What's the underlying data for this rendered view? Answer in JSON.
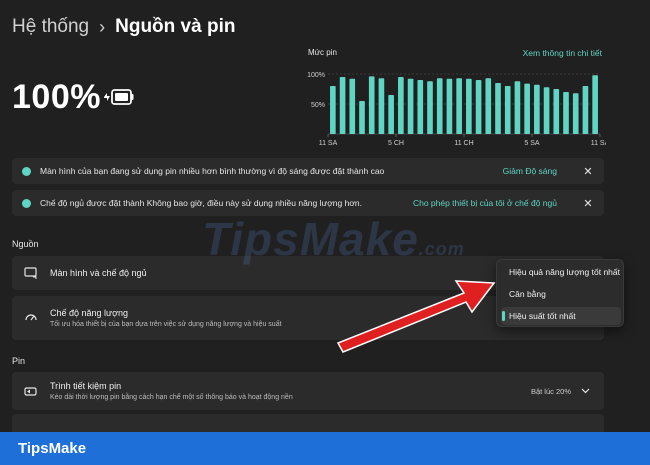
{
  "breadcrumb": {
    "parent": "Hệ thống",
    "separator": "›",
    "current": "Nguồn và pin"
  },
  "battery": {
    "percent": "100%"
  },
  "chart_data": {
    "type": "bar",
    "title": "Mức pin",
    "link": "Xem thông tin chi tiết",
    "yticks": [
      "100%",
      "50%"
    ],
    "ylim": [
      0,
      100
    ],
    "xticks": [
      "11 SA",
      "5 CH",
      "11 CH",
      "5 SA",
      "11 SA"
    ],
    "values": [
      80,
      95,
      92,
      55,
      96,
      93,
      65,
      95,
      92,
      90,
      88,
      93,
      92,
      93,
      92,
      90,
      93,
      85,
      80,
      88,
      84,
      82,
      78,
      75,
      70,
      68,
      80,
      98
    ]
  },
  "notices": [
    {
      "text": "Màn hình của bạn đang sử dụng pin nhiều hơn bình thường vì độ sáng được đặt thành cao",
      "action": "Giảm Độ sáng"
    },
    {
      "text": "Chế độ ngủ được đặt thành Không bao giờ, điều này sử dụng nhiều năng lượng hơn.",
      "action": "Cho phép thiết bị của tôi ở chế độ ngủ"
    }
  ],
  "sections": {
    "power": "Nguồn",
    "battery": "Pin"
  },
  "cards": {
    "screen_sleep": {
      "title": "Màn hình và chế độ ngủ"
    },
    "power_mode": {
      "title": "Chế độ năng lượng",
      "subtitle": "Tối ưu hóa thiết bị của bạn dựa trên việc sử dụng năng lượng và hiệu suất"
    },
    "battery_saver": {
      "title": "Trình tiết kiệm pin",
      "subtitle": "Kéo dài thời lượng pin bằng cách hạn chế một số thông báo và hoạt động nền",
      "value": "Bật lúc 20%"
    }
  },
  "dropdown": {
    "options": [
      "Hiệu quả năng lượng tốt nhất",
      "Cân bằng",
      "Hiệu suất tốt nhất"
    ],
    "selected_index": 2
  },
  "watermark": {
    "text": "TipsMake",
    "suffix": ".com"
  },
  "footer": {
    "brand": "TipsMake"
  },
  "colors": {
    "accent": "#5fd5c3",
    "arrow": "#e02020",
    "footer": "#1f6fd8"
  }
}
